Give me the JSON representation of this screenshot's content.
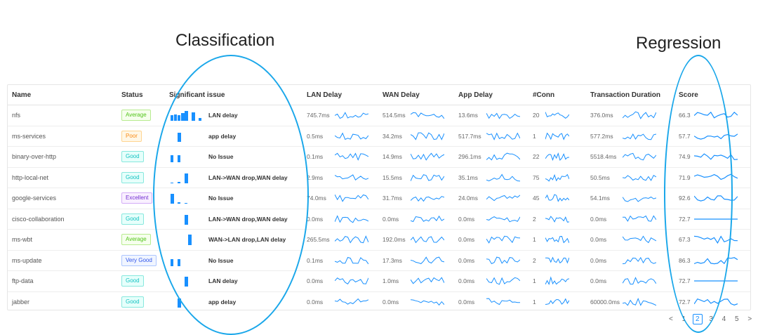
{
  "annotations": {
    "classification": "Classification",
    "regression": "Regression"
  },
  "columns": [
    "Name",
    "Status",
    "Significant issue",
    "LAN Delay",
    "WAN Delay",
    "App Delay",
    "#Conn",
    "Transaction Duration",
    "Score"
  ],
  "rows": [
    {
      "name": "nfs",
      "status": "Average",
      "issue": "LAN delay",
      "lan": "745.7ms",
      "wan": "514.5ms",
      "app": "13.6ms",
      "conn": "20",
      "trans": "376.0ms",
      "score": "66.3"
    },
    {
      "name": "ms-services",
      "status": "Poor",
      "issue": "app delay",
      "lan": "0.5ms",
      "wan": "34.2ms",
      "app": "517.7ms",
      "conn": "1",
      "trans": "577.2ms",
      "score": "57.7"
    },
    {
      "name": "binary-over-http",
      "status": "Good",
      "issue": "No Issue",
      "lan": "0.1ms",
      "wan": "14.9ms",
      "app": "296.1ms",
      "conn": "22",
      "trans": "5518.4ms",
      "score": "74.9"
    },
    {
      "name": "http-local-net",
      "status": "Good",
      "issue": "LAN->WAN drop,WAN delay",
      "lan": "2.9ms",
      "wan": "15.5ms",
      "app": "35.1ms",
      "conn": "75",
      "trans": "50.5ms",
      "score": "71.9"
    },
    {
      "name": "google-services",
      "status": "Excellent",
      "issue": "No Issue",
      "lan": "74.0ms",
      "wan": "31.7ms",
      "app": "24.0ms",
      "conn": "45",
      "trans": "54.1ms",
      "score": "92.6"
    },
    {
      "name": "cisco-collaboration",
      "status": "Good",
      "issue": "LAN->WAN drop,WAN delay",
      "lan": "0.0ms",
      "wan": "0.0ms",
      "app": "0.0ms",
      "conn": "2",
      "trans": "0.0ms",
      "score": "72.7"
    },
    {
      "name": "ms-wbt",
      "status": "Average",
      "issue": "WAN->LAN drop,LAN delay",
      "lan": "265.5ms",
      "wan": "192.0ms",
      "app": "0.0ms",
      "conn": "1",
      "trans": "0.0ms",
      "score": "67.3"
    },
    {
      "name": "ms-update",
      "status": "Very Good",
      "issue": "No Issue",
      "lan": "0.1ms",
      "wan": "17.3ms",
      "app": "0.0ms",
      "conn": "2",
      "trans": "0.0ms",
      "score": "86.3"
    },
    {
      "name": "ftp-data",
      "status": "Good",
      "issue": "LAN delay",
      "lan": "0.0ms",
      "wan": "1.0ms",
      "app": "0.0ms",
      "conn": "1",
      "trans": "0.0ms",
      "score": "72.7"
    },
    {
      "name": "jabber",
      "status": "Good",
      "issue": "app delay",
      "lan": "0.0ms",
      "wan": "0.0ms",
      "app": "0.0ms",
      "conn": "1",
      "trans": "60000.0ms",
      "score": "72.7"
    }
  ],
  "status_colors": {
    "Average": {
      "fg": "#52c41a",
      "bg": "#f6ffed",
      "bd": "#b7eb8f"
    },
    "Poor": {
      "fg": "#fa8c16",
      "bg": "#fff7e6",
      "bd": "#ffd591"
    },
    "Good": {
      "fg": "#13c2c2",
      "bg": "#e6fffb",
      "bd": "#87e8de"
    },
    "Excellent": {
      "fg": "#722ed1",
      "bg": "#f9f0ff",
      "bd": "#d3adf7"
    },
    "Very Good": {
      "fg": "#2f54eb",
      "bg": "#f0f5ff",
      "bd": "#adc6ff"
    }
  },
  "accent_color": "#1890ff",
  "pagination": {
    "prev": "<",
    "pages": [
      "1",
      "2",
      "3",
      "4",
      "5"
    ],
    "current": "2",
    "next": ">"
  }
}
